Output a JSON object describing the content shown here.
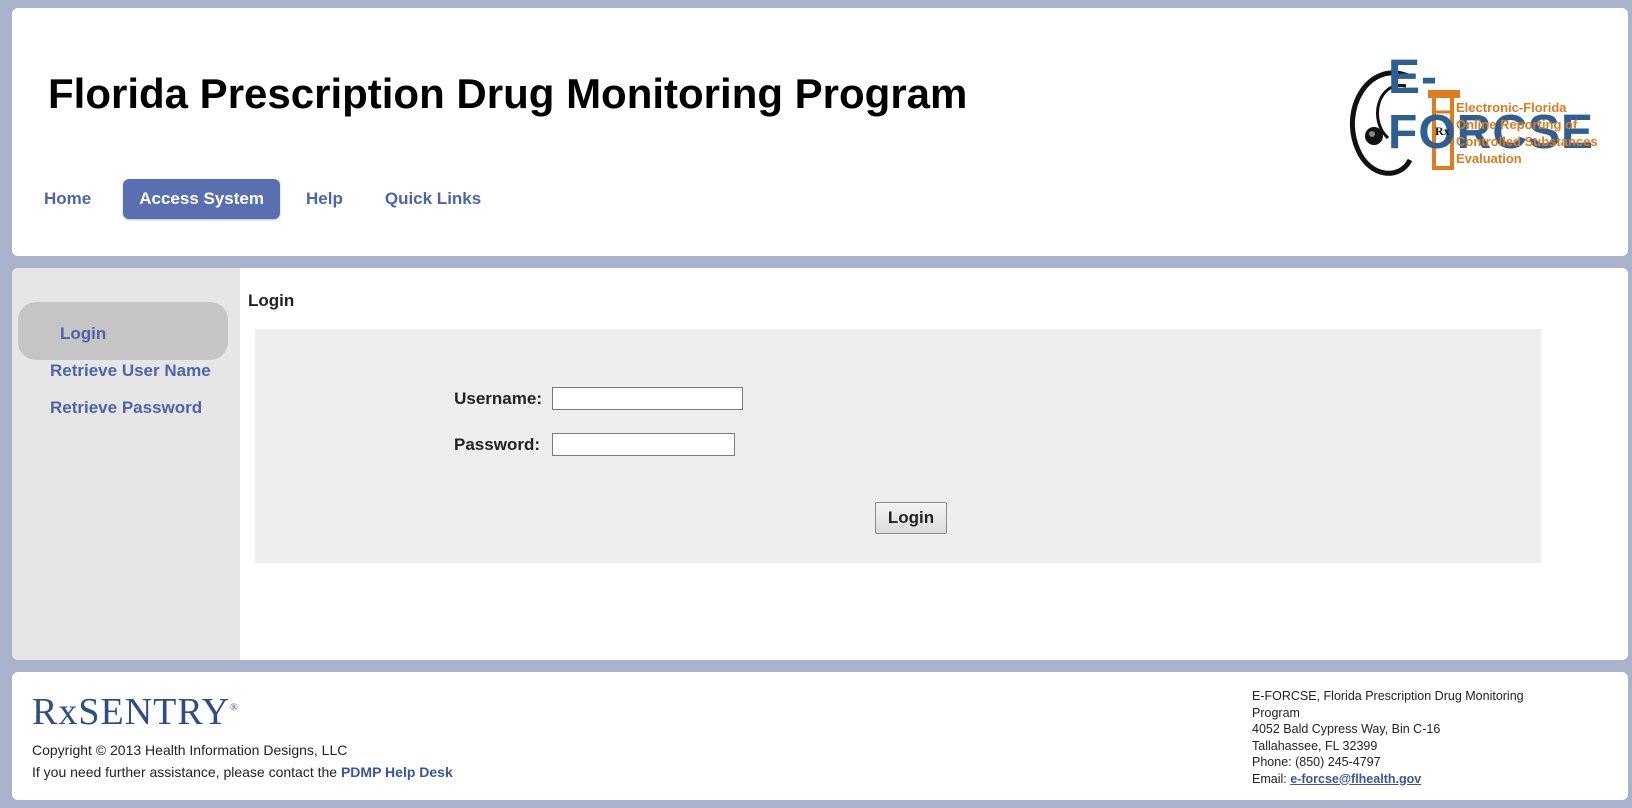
{
  "header": {
    "title": "Florida Prescription Drug Monitoring Program",
    "nav": [
      {
        "label": "Home",
        "active": false
      },
      {
        "label": "Access System",
        "active": true
      },
      {
        "label": "Help",
        "active": false
      },
      {
        "label": "Quick Links",
        "active": false
      }
    ],
    "logo": {
      "title": "E-FORCSE",
      "line1": "Electronic-Florida",
      "line2": "Online Reporting of",
      "line3": "Controlled Substances",
      "line4": "Evaluation",
      "rx": "Rx"
    }
  },
  "sidebar": {
    "active": "Login",
    "links": [
      "Retrieve User Name",
      "Retrieve Password"
    ]
  },
  "main": {
    "section_title": "Login",
    "username_label": "Username:",
    "password_label": "Password:",
    "username_value": "",
    "password_value": "",
    "login_button": "Login"
  },
  "footer": {
    "brand_rx": "Rx",
    "brand_name": "SENTRY",
    "copyright": "Copyright © 2013 Health Information Designs, LLC",
    "assist_text": "If you need further assistance, please contact the",
    "assist_link": "PDMP Help Desk",
    "contact": {
      "line1": "E-FORCSE, Florida Prescription Drug Monitoring Program",
      "line2": "4052 Bald Cypress Way, Bin C-16",
      "line3": "Tallahassee, FL 32399",
      "line4": "Phone: (850) 245-4797",
      "email_label": "Email:",
      "email": "e-forcse@flhealth.gov"
    }
  },
  "colors": {
    "page_bg": "#a9b3cc",
    "link": "#4d64a8",
    "active_nav": "#5a6fb0",
    "logo_blue": "#2e5f93",
    "logo_orange": "#e07b1f"
  }
}
